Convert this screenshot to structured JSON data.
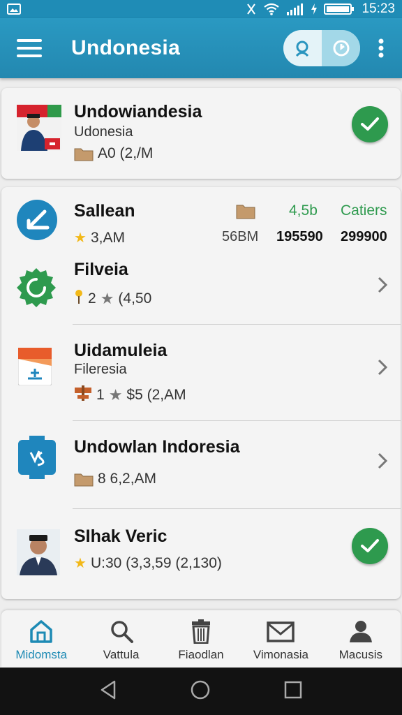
{
  "status_bar": {
    "time": "15:23"
  },
  "app_bar": {
    "title": "Undonesia"
  },
  "header_card": {
    "title": "Undowiandesia",
    "subtitle": "Udonesia",
    "meta": "A0 (2,/M"
  },
  "list": {
    "summary": {
      "title": "SalIean",
      "meta": "3,AM",
      "col_top_1": "4,5b",
      "col_top_2": "Catiers",
      "col_bottom_0": "56BM",
      "col_bottom_1": "195590",
      "col_bottom_2": "299900"
    },
    "items": [
      {
        "title": "Filveia",
        "meta_a": "2",
        "meta_b": "(4,50"
      },
      {
        "title": "Uidamuleia",
        "subtitle": "Fileresia",
        "meta_a": "1",
        "meta_b": "$5 (2,AM"
      },
      {
        "title": "Undowlan Indoresia",
        "meta": "8 6,2,AM"
      },
      {
        "title": "SIhak Veric",
        "meta": "U:30 (3,3,59 (2,130)"
      }
    ]
  },
  "bottom_nav": [
    {
      "label": "Midomsta",
      "icon": "home-icon"
    },
    {
      "label": "Vattula",
      "icon": "search-icon"
    },
    {
      "label": "Fiaodlan",
      "icon": "trash-icon"
    },
    {
      "label": "Vimonasia",
      "icon": "mail-icon"
    },
    {
      "label": "Macusis",
      "icon": "person-icon"
    }
  ],
  "colors": {
    "accent": "#2388b0",
    "success": "#2e9a4e",
    "star": "#f2b818"
  }
}
